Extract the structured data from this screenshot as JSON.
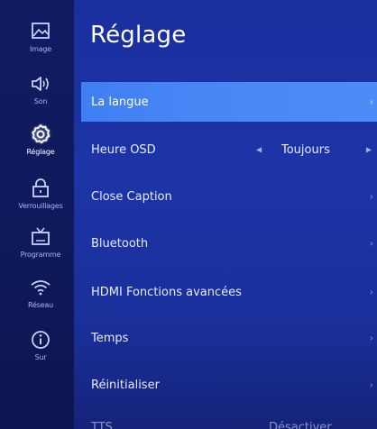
{
  "sidebar": {
    "items": [
      {
        "label": "Image",
        "icon": "picture-icon"
      },
      {
        "label": "Son",
        "icon": "speaker-icon"
      },
      {
        "label": "Réglage",
        "icon": "gear-icon"
      },
      {
        "label": "Verrouillages",
        "icon": "lock-icon"
      },
      {
        "label": "Programme",
        "icon": "tv-icon"
      },
      {
        "label": "Réseau",
        "icon": "wifi-icon"
      },
      {
        "label": "Sur",
        "icon": "info-icon"
      }
    ],
    "active_index": 2
  },
  "page": {
    "title": "Réglage"
  },
  "menu": {
    "items": [
      {
        "label": "La langue",
        "selected": true
      },
      {
        "label": "Heure OSD",
        "value": "Toujours"
      },
      {
        "label": "Close Caption"
      },
      {
        "label": "Bluetooth"
      },
      {
        "label": "HDMI Fonctions avancées"
      },
      {
        "label": "Temps"
      },
      {
        "label": "Réinitialiser"
      },
      {
        "label": "TTS",
        "value": "Désactiver"
      }
    ]
  },
  "colors": {
    "background": "#1a2f9e",
    "rail": "#0f1a5c",
    "selection": "#4a8af6",
    "text": "#e7ecff"
  }
}
